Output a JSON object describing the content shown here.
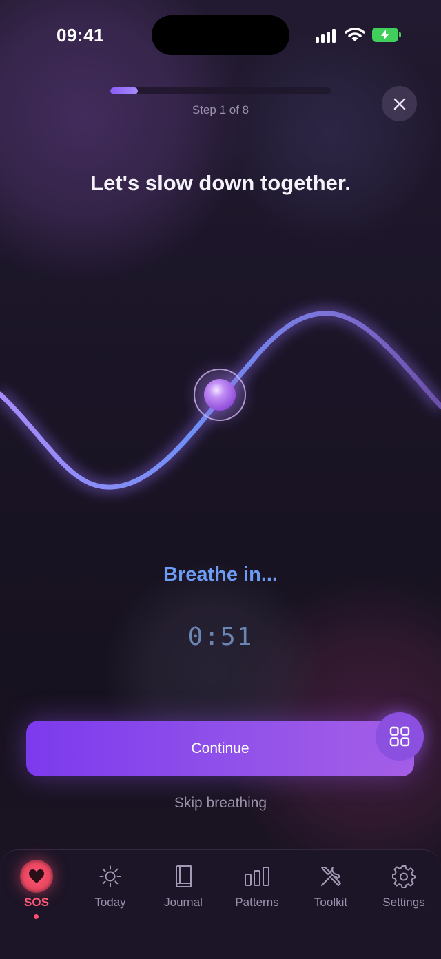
{
  "status_bar": {
    "time": "09:41"
  },
  "progress": {
    "fraction": 0.125,
    "step_label": "Step 1 of 8"
  },
  "close": {
    "icon": "close-icon"
  },
  "headline": "Let's slow down together.",
  "breathe": {
    "prompt": "Breathe in...",
    "timer": "0:51"
  },
  "actions": {
    "continue_label": "Continue",
    "skip_label": "Skip breathing",
    "grid_icon": "grid-icon"
  },
  "tabs": [
    {
      "label": "SOS",
      "icon": "heart-icon",
      "active": true
    },
    {
      "label": "Today",
      "icon": "sun-icon",
      "active": false
    },
    {
      "label": "Journal",
      "icon": "book-icon",
      "active": false
    },
    {
      "label": "Patterns",
      "icon": "bars-icon",
      "active": false
    },
    {
      "label": "Toolkit",
      "icon": "tools-icon",
      "active": false
    },
    {
      "label": "Settings",
      "icon": "gear-icon",
      "active": false
    }
  ],
  "colors": {
    "accent": "#8b5cf6",
    "breathe_text": "#6d9cf5",
    "sos_active": "#ff5a78",
    "battery": "#3fcf5a"
  }
}
